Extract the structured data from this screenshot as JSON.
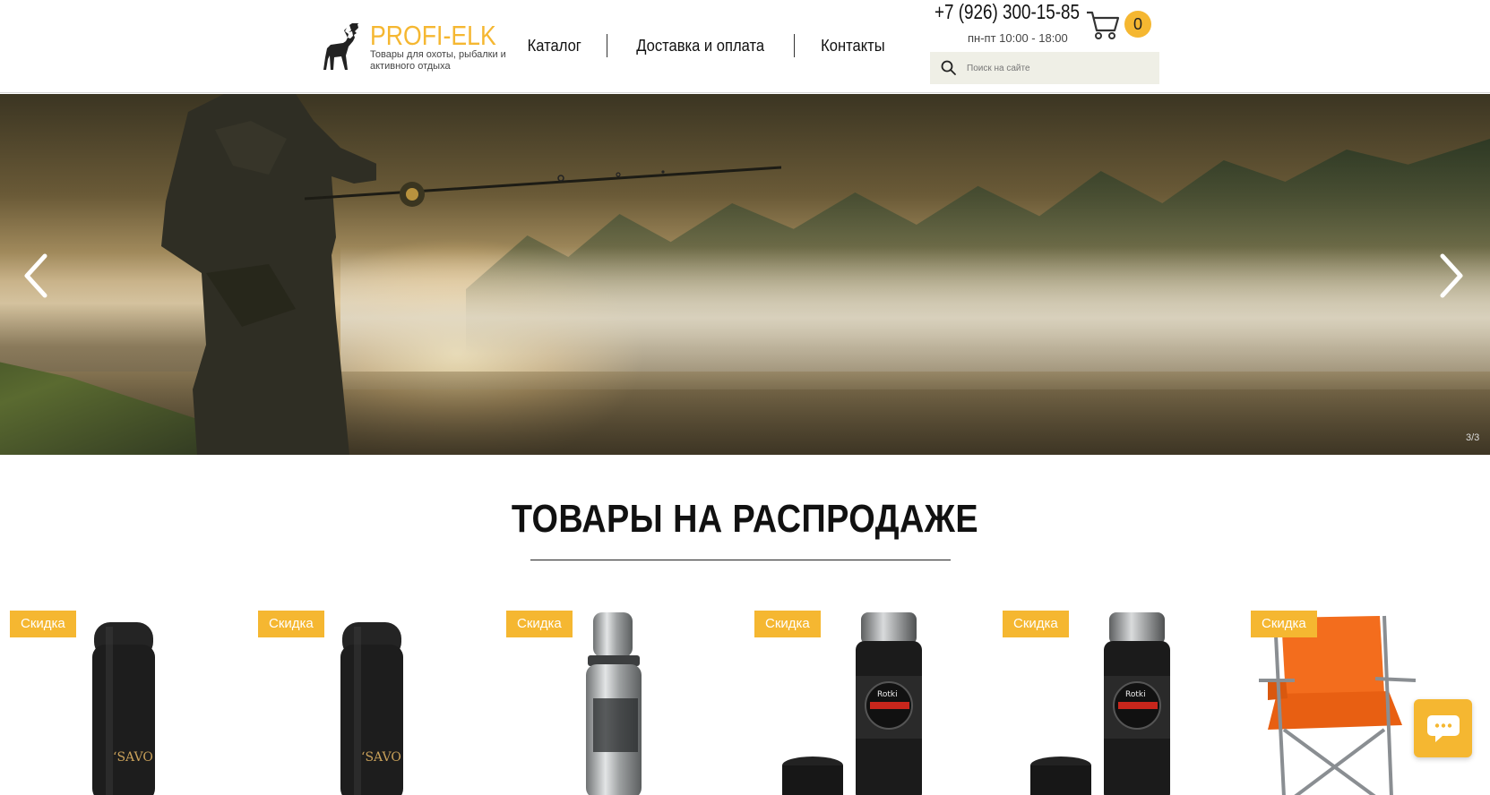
{
  "brand": {
    "name": "PROFI-ELK",
    "tagline": "Товары для охоты, рыбалки и активного отдыха",
    "accent_color": "#f5b731"
  },
  "nav": {
    "items": [
      {
        "label": "Каталог"
      },
      {
        "label": "Доставка и оплата"
      },
      {
        "label": "Контакты"
      }
    ]
  },
  "contact": {
    "phone": "+7 (926) 300-15-85",
    "hours": "пн-пт 10:00 - 18:00"
  },
  "cart": {
    "count": "0",
    "icon": "cart-icon"
  },
  "search": {
    "placeholder": "Поиск на сайте",
    "value": "",
    "icon": "search-icon"
  },
  "slideshow": {
    "counter": "3/3",
    "prev_icon": "chevron-left-icon",
    "next_icon": "chevron-right-icon"
  },
  "sale_section": {
    "title": "ТОВАРЫ НА РАСПРОДАЖЕ"
  },
  "products": [
    {
      "badge": "Скидка",
      "kind": "thermos-black-savotti"
    },
    {
      "badge": "Скидка",
      "kind": "thermos-black-savotti"
    },
    {
      "badge": "Скидка",
      "kind": "thermos-steel"
    },
    {
      "badge": "Скидка",
      "kind": "thermos-rotki"
    },
    {
      "badge": "Скидка",
      "kind": "thermos-rotki"
    },
    {
      "badge": "Скидка",
      "kind": "folding-chair-orange"
    }
  ],
  "chat": {
    "icon": "chat-icon"
  }
}
